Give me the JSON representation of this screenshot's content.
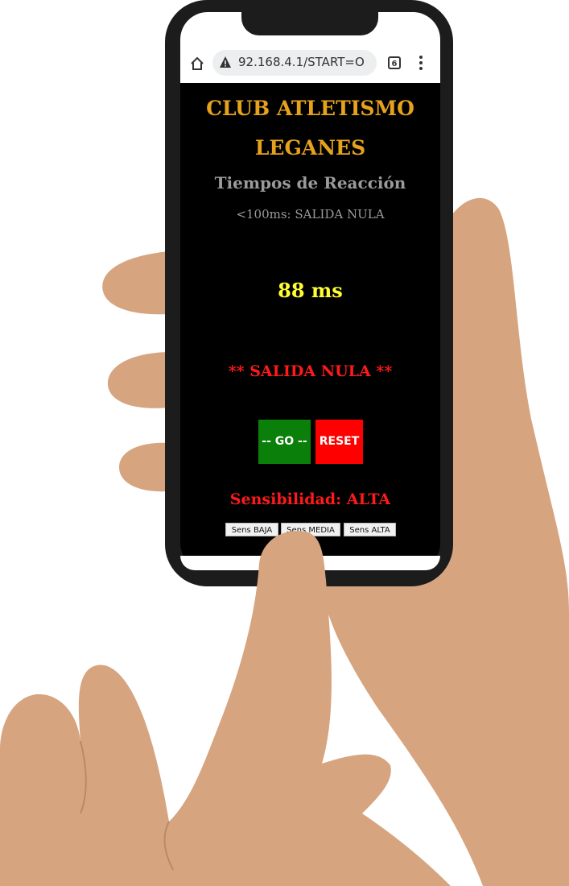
{
  "browser": {
    "url": "92.168.4.1/START=O",
    "tab_count": "6"
  },
  "app": {
    "title_line1": "CLUB ATLETISMO",
    "title_line2": "LEGANES",
    "subtitle": "Tiempos de Reacción",
    "threshold_note": "<100ms: SALIDA NULA",
    "reaction_time": "88 ms",
    "result_status": "** SALIDA NULA **",
    "go_label": "-- GO --",
    "reset_label": "RESET",
    "sensitivity_text": "Sensibilidad: ALTA",
    "sens_buttons": [
      "Sens BAJA",
      "Sens MEDIA",
      "Sens ALTA"
    ]
  },
  "colors": {
    "title": "#e7a21d",
    "time": "#ffff33",
    "alert": "#ff1a1a",
    "go_button": "#0a7f0a",
    "reset_button": "#ff0000",
    "skin": "#d6a580"
  }
}
